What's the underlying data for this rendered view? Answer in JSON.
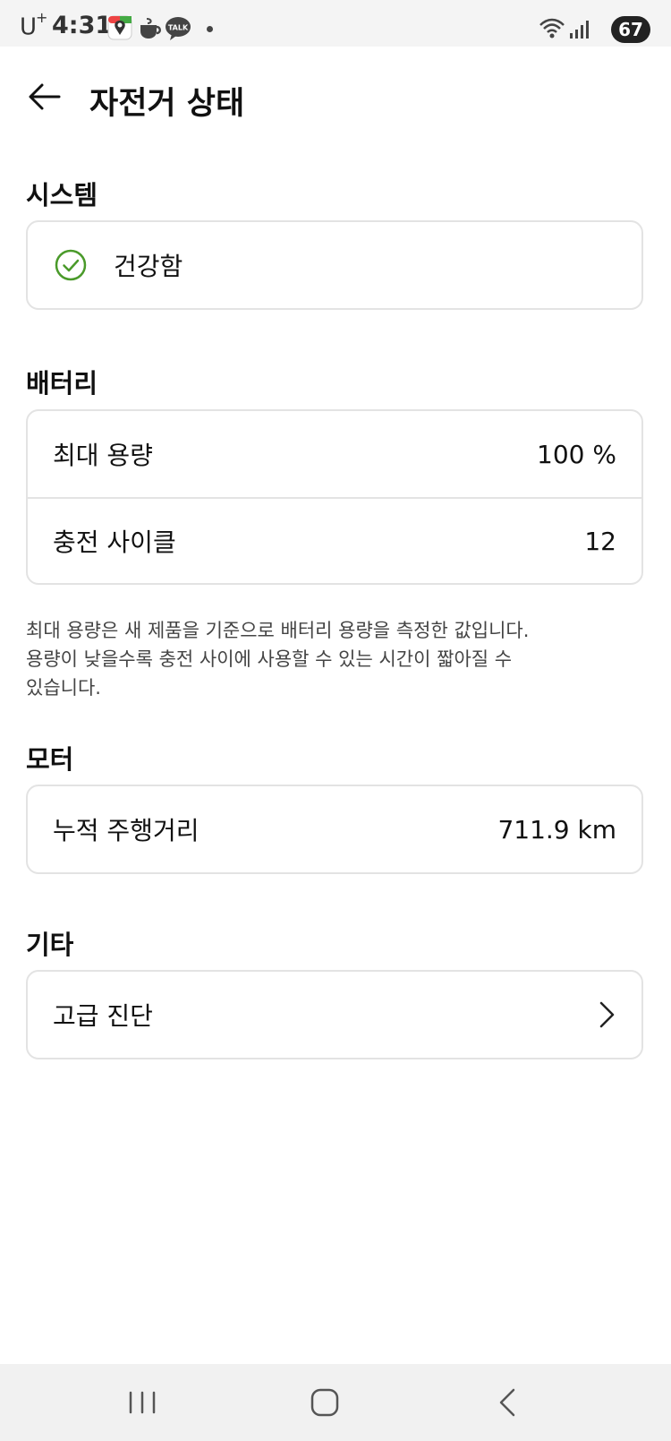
{
  "status_bar": {
    "carrier": "U",
    "carrier_sup": "+",
    "time": "4:31",
    "battery": "67",
    "notification_icons": [
      "maps-icon",
      "coffee-icon",
      "kakaotalk-icon"
    ]
  },
  "header": {
    "title": "자전거 상태"
  },
  "sections": {
    "system": {
      "title": "시스템",
      "status_label": "건강함",
      "status_color": "#4a9a2a"
    },
    "battery": {
      "title": "배터리",
      "rows": [
        {
          "label": "최대 용량",
          "value": "100 %"
        },
        {
          "label": "충전 사이클",
          "value": "12"
        }
      ],
      "note_lines": [
        "최대 용량은 새 제품을 기준으로 배터리 용량을 측정한 값입니다.",
        "용량이 낮을수록 충전 사이에 사용할 수 있는 시간이 짧아질 수",
        "있습니다."
      ]
    },
    "motor": {
      "title": "모터",
      "rows": [
        {
          "label": "누적 주행거리",
          "value": "711.9 km"
        }
      ]
    },
    "etc": {
      "title": "기타",
      "rows": [
        {
          "label": "고급 진단"
        }
      ]
    }
  },
  "nav_bar": {
    "buttons": [
      "recent-apps",
      "home",
      "back"
    ]
  }
}
